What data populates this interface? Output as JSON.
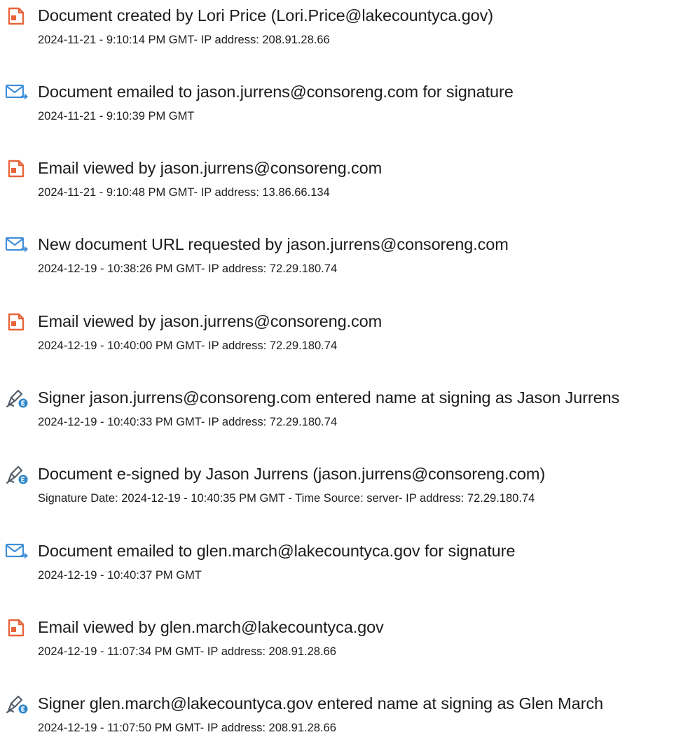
{
  "entries": [
    {
      "icon": "document-icon",
      "title": "Document created by Lori Price (Lori.Price@lakecountyca.gov)",
      "meta": "2024-11-21 - 9:10:14 PM GMT- IP address: 208.91.28.66"
    },
    {
      "icon": "email-sent-icon",
      "title": "Document emailed to jason.jurrens@consoreng.com for signature",
      "meta": "2024-11-21 - 9:10:39 PM GMT"
    },
    {
      "icon": "document-icon",
      "title": "Email viewed by jason.jurrens@consoreng.com",
      "meta": "2024-11-21 - 9:10:48 PM GMT- IP address: 13.86.66.134"
    },
    {
      "icon": "email-sent-icon",
      "title": "New document URL requested by jason.jurrens@consoreng.com",
      "meta": "2024-12-19 - 10:38:26 PM GMT- IP address: 72.29.180.74"
    },
    {
      "icon": "document-icon",
      "title": "Email viewed by jason.jurrens@consoreng.com",
      "meta": "2024-12-19 - 10:40:00 PM GMT- IP address: 72.29.180.74"
    },
    {
      "icon": "pen-sign-icon",
      "title": "Signer jason.jurrens@consoreng.com entered name at signing as Jason Jurrens",
      "meta": "2024-12-19 - 10:40:33 PM GMT- IP address: 72.29.180.74"
    },
    {
      "icon": "pen-sign-icon",
      "title": "Document e-signed by Jason Jurrens (jason.jurrens@consoreng.com)",
      "meta": "Signature Date: 2024-12-19 - 10:40:35 PM GMT - Time Source: server- IP address: 72.29.180.74"
    },
    {
      "icon": "email-sent-icon",
      "title": "Document emailed to glen.march@lakecountyca.gov for signature",
      "meta": "2024-12-19 - 10:40:37 PM GMT"
    },
    {
      "icon": "document-icon",
      "title": "Email viewed by glen.march@lakecountyca.gov",
      "meta": "2024-12-19 - 11:07:34 PM GMT- IP address: 208.91.28.66"
    },
    {
      "icon": "pen-sign-icon",
      "title": "Signer glen.march@lakecountyca.gov entered name at signing as Glen March",
      "meta": "2024-12-19 - 11:07:50 PM GMT- IP address: 208.91.28.66"
    }
  ],
  "colors": {
    "document_icon": "#e8643a",
    "email_icon": "#3f8fd8",
    "sign_icon_stroke": "#555f6b",
    "sign_icon_badge": "#2f86c9"
  }
}
